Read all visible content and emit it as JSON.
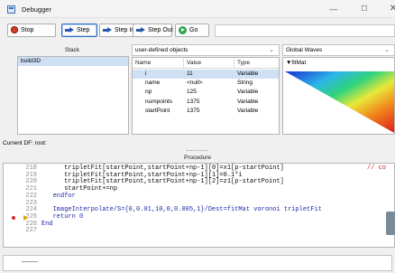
{
  "window": {
    "title": "Debugger",
    "minimize": "—",
    "maximize": "☐",
    "close": "✕"
  },
  "toolbar": {
    "stop": "Stop",
    "step": "Step",
    "step_in": "Step In",
    "step_out": "Step Out",
    "go": "Go"
  },
  "stack": {
    "header": "Stack",
    "items": [
      "build3D"
    ]
  },
  "variables": {
    "selector": "user-defined objects",
    "columns": {
      "name": "Name",
      "value": "Value",
      "type": "Type"
    },
    "rows": [
      {
        "name": "i",
        "value": "11",
        "type": "Variable",
        "selected": true
      },
      {
        "name": "name",
        "value": "<null>",
        "type": "String"
      },
      {
        "name": "np",
        "value": "125",
        "type": "Variable"
      },
      {
        "name": "numpoints",
        "value": "1375",
        "type": "Variable"
      },
      {
        "name": "startPoint",
        "value": "1375",
        "type": "Variable"
      }
    ]
  },
  "waves": {
    "selector": "Global Waves",
    "items": [
      {
        "name": "▼fitMat"
      }
    ],
    "plot_colors": [
      "#1a2fd6",
      "#2bb5e8",
      "#2fd37c",
      "#e8e83a",
      "#f08a1c",
      "#e01b1b"
    ]
  },
  "current_df": {
    "label": "Current DF:",
    "value": "root:"
  },
  "procedure": {
    "header": "Procedure",
    "breakpoint_line": 225,
    "pc_line": 225,
    "lines": [
      {
        "num": "218",
        "text": "      tripletFit[startPoint,startPoint+np-1][0]=x1[p-startPoint]",
        "comment": "// co"
      },
      {
        "num": "219",
        "text": "      tripletFit[startPoint,startPoint+np-1][1]=0.1*i"
      },
      {
        "num": "220",
        "text": "      tripletFit[startPoint,startPoint+np-1][2]=z1[p-startPoint]"
      },
      {
        "num": "221",
        "text": "      startPoint+=np"
      },
      {
        "num": "222",
        "text": "   endfor"
      },
      {
        "num": "223",
        "text": ""
      },
      {
        "num": "224",
        "text": "   ImageInterpolate/S={0,0.01,10,0,0.005,1}/Dest=fitMat voronoi tripletFit"
      },
      {
        "num": "225",
        "text": "   return 0"
      },
      {
        "num": "226",
        "text": "End"
      },
      {
        "num": "227",
        "text": ""
      }
    ]
  },
  "status": {
    "text": ""
  }
}
